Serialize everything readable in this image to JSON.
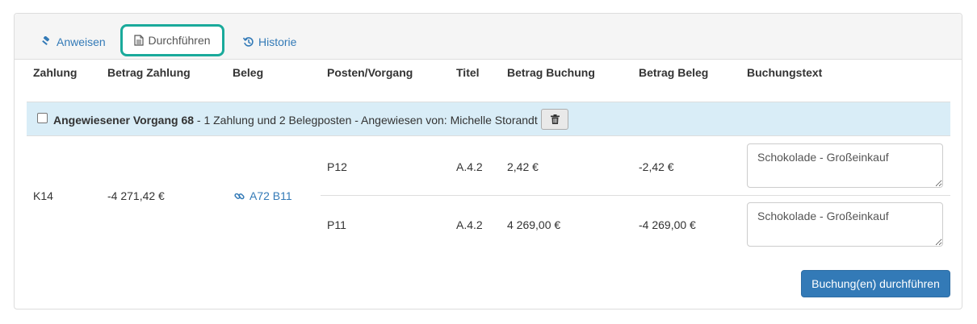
{
  "tabs": [
    {
      "label": "Anweisen",
      "icon": "gavel-icon"
    },
    {
      "label": "Durchführen",
      "icon": "document-icon",
      "active": true
    },
    {
      "label": "Historie",
      "icon": "history-icon"
    }
  ],
  "table": {
    "headers": [
      "Zahlung",
      "Betrag Zahlung",
      "Beleg",
      "Posten/Vorgang",
      "Titel",
      "Betrag Buchung",
      "Betrag Beleg",
      "Buchungstext"
    ],
    "group": {
      "title": "Angewiesener Vorgang 68",
      "details": " - 1 Zahlung und 2 Belegposten - Angewiesen von: Michelle Storandt",
      "checked": false
    },
    "payment": {
      "zahlung": "K14",
      "betrag": "-4 271,42 €",
      "beleg": "A72 B11"
    },
    "rows": [
      {
        "posten": "P12",
        "titel": "A.4.2",
        "betrag_buchung": "2,42 €",
        "betrag_beleg": "-2,42 €",
        "buchungstext": "Schokolade - Großeinkauf"
      },
      {
        "posten": "P11",
        "titel": "A.4.2",
        "betrag_buchung": "4 269,00 €",
        "betrag_beleg": "-4 269,00 €",
        "buchungstext": "Schokolade - Großeinkauf"
      }
    ]
  },
  "submit_label": "Buchung(en) durchführen",
  "colors": {
    "link": "#337ab7",
    "highlight": "#1aaa9b",
    "group_bg": "#d9edf7",
    "primary": "#337ab7"
  }
}
